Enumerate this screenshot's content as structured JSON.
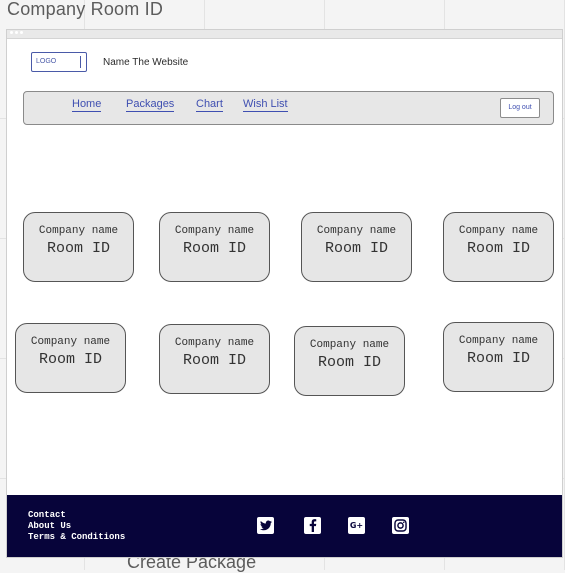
{
  "canvas": {
    "title": "Company Room ID",
    "bottom_label": "Create Package"
  },
  "header": {
    "logo_text": "LOGO",
    "site_name": "Name The Website"
  },
  "nav": {
    "links": [
      "Home",
      "Packages",
      "Chart",
      "Wish List"
    ],
    "logout_label": "Log out"
  },
  "cards": [
    {
      "company": "Company name",
      "room": "Room ID"
    },
    {
      "company": "Company name",
      "room": "Room ID"
    },
    {
      "company": "Company name",
      "room": "Room ID"
    },
    {
      "company": "Company name",
      "room": "Room ID"
    },
    {
      "company": "Company name",
      "room": "Room ID"
    },
    {
      "company": "Company name",
      "room": "Room ID"
    },
    {
      "company": "Company name",
      "room": "Room ID"
    },
    {
      "company": "Company name",
      "room": "Room ID"
    }
  ],
  "footer": {
    "links": [
      "Contact",
      "About Us",
      "Terms & Conditions"
    ],
    "social_icons": [
      "twitter-icon",
      "facebook-icon",
      "google-plus-icon",
      "instagram-icon"
    ]
  },
  "colors": {
    "link": "#3f4fb1",
    "footer_bg": "#07043a",
    "card_bg": "#e6e6e6"
  }
}
